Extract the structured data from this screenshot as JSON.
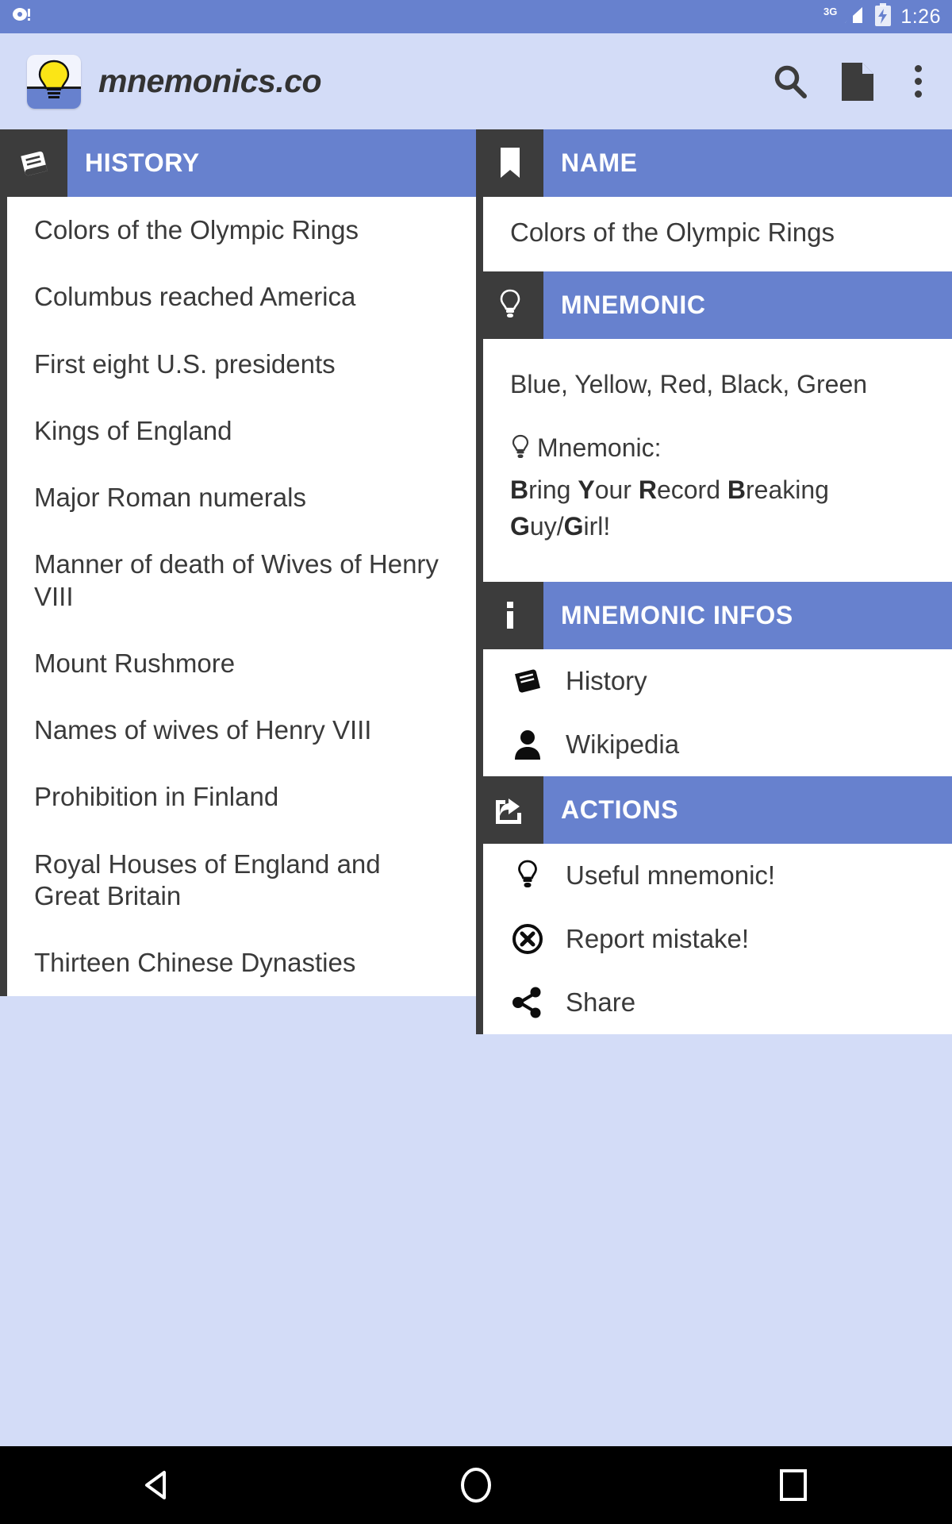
{
  "status_bar": {
    "notification_icon": "notification-icon",
    "network": "3G",
    "battery_icon": "battery-charging-icon",
    "time": "1:26"
  },
  "app_bar": {
    "logo_icon": "lightbulb-logo-icon",
    "title": "mnemonics.co",
    "actions": [
      {
        "name": "search-icon",
        "label": "Search"
      },
      {
        "name": "document-icon",
        "label": "Document"
      },
      {
        "name": "overflow-menu-icon",
        "label": "More options"
      }
    ]
  },
  "colors": {
    "accent_blue": "#6781ce",
    "page_background": "#d3dcf7",
    "icon_box_dark": "#3c3c3c",
    "panel_white": "#ffffff",
    "text_dark": "#3a3a3a",
    "nav_bar": "#000000"
  },
  "history_panel": {
    "header": {
      "icon": "book-icon",
      "title": "HISTORY"
    },
    "items": [
      "Colors of the Olympic Rings",
      "Columbus reached America",
      "First eight U.S. presidents",
      "Kings of England",
      "Major Roman numerals",
      "Manner of death of Wives of Henry VIII",
      "Mount Rushmore",
      "Names of wives of Henry VIII",
      "Prohibition in Finland",
      "Royal Houses of England and Great Britain",
      "Thirteen Chinese Dynasties"
    ]
  },
  "detail_panel": {
    "name_section": {
      "header": {
        "icon": "bookmark-icon",
        "title": "NAME"
      },
      "value": "Colors of the Olympic Rings"
    },
    "mnemonic_section": {
      "header": {
        "icon": "lightbulb-icon",
        "title": "MNEMONIC"
      },
      "answer": "Blue, Yellow, Red, Black, Green",
      "mnemonic_label": "Mnemonic:",
      "mnemonic_label_icon": "lightbulb-icon",
      "phrase_parts": [
        {
          "bold": "B",
          "rest": "ring "
        },
        {
          "bold": "Y",
          "rest": "our "
        },
        {
          "bold": "R",
          "rest": "ecord "
        },
        {
          "bold": "B",
          "rest": "reaking "
        },
        {
          "bold": "G",
          "rest": "uy/"
        },
        {
          "bold": "G",
          "rest": "irl!"
        }
      ]
    },
    "infos_section": {
      "header": {
        "icon": "info-icon",
        "title": "MNEMONIC INFOS"
      },
      "items": [
        {
          "icon": "book-icon",
          "label": "History"
        },
        {
          "icon": "person-icon",
          "label": "Wikipedia"
        }
      ]
    },
    "actions_section": {
      "header": {
        "icon": "share-export-icon",
        "title": "ACTIONS"
      },
      "items": [
        {
          "icon": "lightbulb-icon",
          "label": "Useful mnemonic!"
        },
        {
          "icon": "report-circle-x-icon",
          "label": "Report mistake!"
        },
        {
          "icon": "share-nodes-icon",
          "label": "Share"
        }
      ]
    }
  },
  "nav_bar": {
    "buttons": [
      {
        "name": "back-button",
        "label": "Back"
      },
      {
        "name": "home-button",
        "label": "Home"
      },
      {
        "name": "recents-button",
        "label": "Recents"
      }
    ]
  }
}
